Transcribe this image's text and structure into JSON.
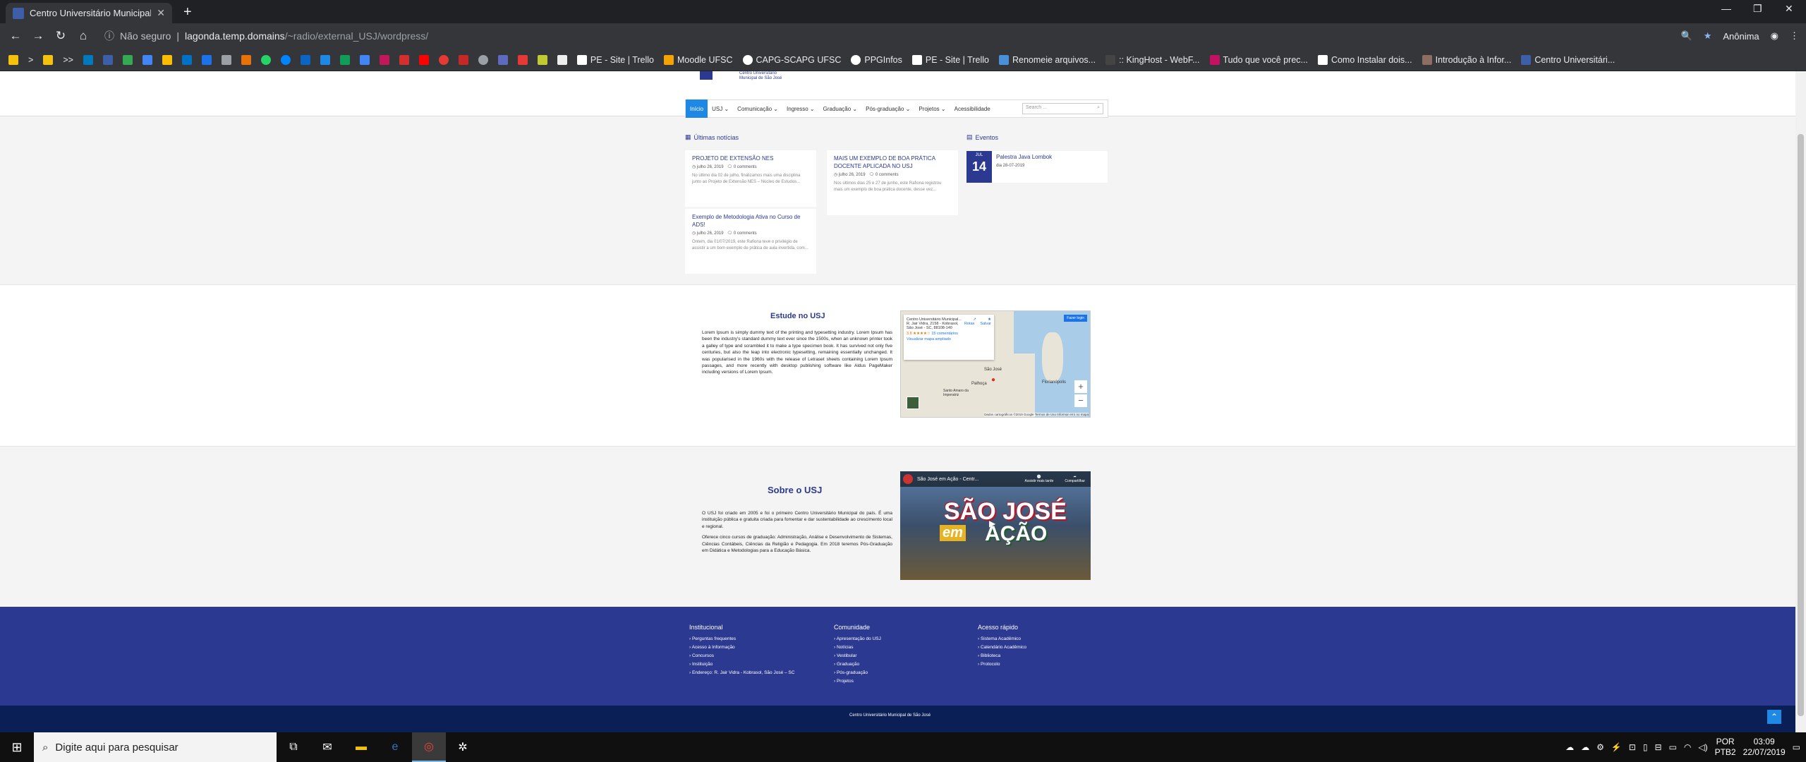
{
  "browser": {
    "tab_title": "Centro Universitário Municipal de",
    "new_tab": "+",
    "close": "✕",
    "security": "Não seguro",
    "url_host": "lagonda.temp.domains",
    "url_path": "/~radio/external_USJ/wordpress/",
    "profile": "Anônima",
    "bookmarks": [
      "PE - Site | Trello",
      "Moodle UFSC",
      "CAPG-SCAPG UFSC",
      "PPGInfos",
      "PE - Site | Trello",
      "Renomeie arquivos...",
      ":: KingHost - WebF...",
      "Tudo que você prec...",
      "Como Instalar dois...",
      "Introdução à Infor...",
      "Centro Universitári..."
    ]
  },
  "site": {
    "logo_line1": "Centro Universitário",
    "logo_line2": "Municipal de São José",
    "menu": [
      "Início",
      "USJ ⌄",
      "Comunicação ⌄",
      "Ingresso ⌄",
      "Graduação ⌄",
      "Pós-graduação ⌄",
      "Projetos ⌄",
      "Acessibilidade"
    ],
    "search_placeholder": "Search ...",
    "news_title": "Últimas notícias",
    "news": [
      {
        "title": "PROJETO DE EXTENSÃO NES",
        "date": "julho 26, 2019",
        "comments": "0 comments",
        "excerpt": "No último dia 02 de julho, finalizamos mais uma disciplina junto ao Projeto de Extensão NES – Núcleo de Estudos..."
      },
      {
        "title": "MAIS UM EXEMPLO DE BOA PRÁTICA DOCENTE APLICADA NO USJ",
        "date": "julho 26, 2019",
        "comments": "0 comments",
        "excerpt": "Nos últimos dias 25 e 27 de junho, este Rafiona registrou mais um exemplo de boa prática docente, desse vez..."
      },
      {
        "title": "Exemplo de Metodologia Ativa no Curso de ADS!",
        "date": "julho 26, 2019",
        "comments": "0 comments",
        "excerpt": "Ontem, dia 01/07/2019, este Rafiona teve o privilégio de assistir a um bom exemplo de prática de aula invertida, com..."
      }
    ],
    "events_title": "Eventos",
    "event": {
      "month": "JUL",
      "day": "14",
      "title": "Palestra Java Lombok",
      "date": "dia 28-07-2019"
    },
    "estude_title": "Estude no USJ",
    "estude_text": "Lorem Ipsum is simply dummy text of the printing and typesetting industry. Lorem Ipsum has been the industry's standard dummy text ever since the 1500s, when an unknown printer took a galley of type and scrambled it to make a type specimen book. It has survived not only five centuries, but also the leap into electronic typesetting, remaining essentially unchanged. It was popularised in the 1960s with the release of Letraset sheets containing Lorem Ipsum passages, and more recently with desktop publishing software like Aldus PageMaker including versions of Lorem Ipsum.",
    "map": {
      "place": "Centro Universitário Municipal...",
      "address": "R. Jair Vidra, 2158 - Kobrasol, São José - SC, 88108-140",
      "rating": "3.8 ★★★★☆",
      "reviews": "15 comentários",
      "larger": "Visualizar mapa ampliado",
      "routes": "Rotas",
      "save": "Salvar",
      "big_btn": "Fazer login",
      "city1": "Florianópolis",
      "city2": "São José",
      "city3": "Palhoça",
      "city4": "Santo Amaro da Imperatriz",
      "footer": "Dados cartográficos ©2019 Google   Termos de Uso   Informar erro no mapa"
    },
    "sobre_title": "Sobre o USJ",
    "sobre_p1": "O USJ foi criado em 2005 e foi o primeiro Centro Universitário Municipal do país. É uma instituição pública e gratuita criada para fomentar e dar sustentabilidade ao crescimento local e regional.",
    "sobre_p2": "Oferece cinco cursos de graduação: Administração, Análise e Desenvolvimento de Sistemas, Ciências Contábeis, Ciências da Religião e Pedagogia. Em 2018 teremos Pós-Graduação em Didática e Metodologias para a Educação Básica.",
    "video": {
      "title": "São José em Ação - Centr...",
      "watch_later": "Assistir mais tarde",
      "share": "Compartilhar",
      "word1": "SÃO JOSÉ",
      "word2": "em",
      "word3": "AÇÃO"
    },
    "footer": {
      "col1_title": "Institucional",
      "col1": [
        "› Perguntas frequentes",
        "› Acesso à Informação",
        "› Concursos",
        "› Instituição",
        "› Endereço: R. Jair Vidra - Kobrasol, São José – SC"
      ],
      "col2_title": "Comunidade",
      "col2": [
        "› Apresentação do USJ",
        "› Notícias",
        "› Vestibular",
        "› Graduação",
        "› Pós-graduação",
        "› Projetos"
      ],
      "col3_title": "Acesso rápido",
      "col3": [
        "› Sistema Acadêmico",
        "› Calendário Acadêmico",
        "› Biblioteca",
        "› Protocolo"
      ],
      "copyright": "Centro Universitário Municipal de São José"
    }
  },
  "taskbar": {
    "search": "Digite aqui para pesquisar",
    "lang1": "POR",
    "lang2": "PTB2",
    "time": "03:09",
    "date": "22/07/2019"
  }
}
